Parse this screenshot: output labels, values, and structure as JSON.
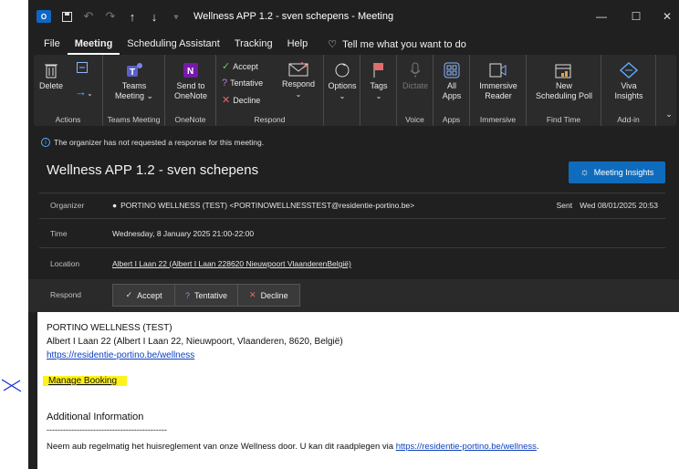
{
  "titlebar": {
    "app_icon_label": "O",
    "title": "Wellness APP 1.2 - sven schepens  -  Meeting"
  },
  "menu": {
    "items": [
      "File",
      "Meeting",
      "Scheduling Assistant",
      "Tracking",
      "Help"
    ],
    "tell_me": "Tell me what you want to do"
  },
  "ribbon": {
    "delete": "Delete",
    "group_actions": "Actions",
    "teams_line1": "Teams",
    "teams_line2": "Meeting ⌄",
    "group_teams": "Teams Meeting",
    "onenote_line1": "Send to",
    "onenote_line2": "OneNote",
    "group_onenote": "OneNote",
    "accept": "Accept",
    "tentative": "Tentative",
    "decline": "Decline",
    "respond": "Respond",
    "group_respond": "Respond",
    "options": "Options",
    "tags": "Tags",
    "dictate": "Dictate",
    "group_voice": "Voice",
    "all_apps_line1": "All",
    "all_apps_line2": "Apps",
    "group_apps": "Apps",
    "immersive_line1": "Immersive",
    "immersive_line2": "Reader",
    "group_immersive": "Immersive",
    "poll_line1": "New",
    "poll_line2": "Scheduling Poll",
    "group_findtime": "Find Time",
    "viva_line1": "Viva",
    "viva_line2": "Insights",
    "group_addin": "Add-in"
  },
  "info": {
    "message": "The organizer has not requested a response for this meeting."
  },
  "meeting": {
    "subject": "Wellness APP 1.2 - sven schepens",
    "insights_button": "Meeting Insights",
    "organizer_label": "Organizer",
    "organizer_value": "PORTINO WELLNESS (TEST) <PORTINOWELLNESSTEST@residentie-portino.be>",
    "sent_label": "Sent",
    "sent_value": "Wed 08/01/2025 20:53",
    "time_label": "Time",
    "time_value": "Wednesday, 8 January 2025 21:00-22:00",
    "location_label": "Location",
    "location_value": "Albert I Laan 22 (Albert I Laan 228620 Nieuwpoort VlaanderenBelgië)",
    "respond_label": "Respond",
    "accept": "Accept",
    "tentative": "Tentative",
    "decline": "Decline"
  },
  "body": {
    "line1": "PORTINO WELLNESS (TEST)",
    "line2": "Albert I Laan 22 (Albert I Laan 22, Nieuwpoort, Vlaanderen, 8620, België)",
    "link1": "https://residentie-portino.be/wellness",
    "manage": "Manage Booking",
    "additional": "Additional Information",
    "dashes": "--------------------------------------------",
    "notice": "Neem aub regelmatig het huisreglement van onze Wellness door. U kan dit raadplegen via ",
    "notice_link": "https://residentie-portino.be/wellness",
    "notice_end": "."
  },
  "colors": {
    "accent": "#0f6cbd",
    "highlight": "#fff21a",
    "annotation": "#1a2fd6"
  }
}
